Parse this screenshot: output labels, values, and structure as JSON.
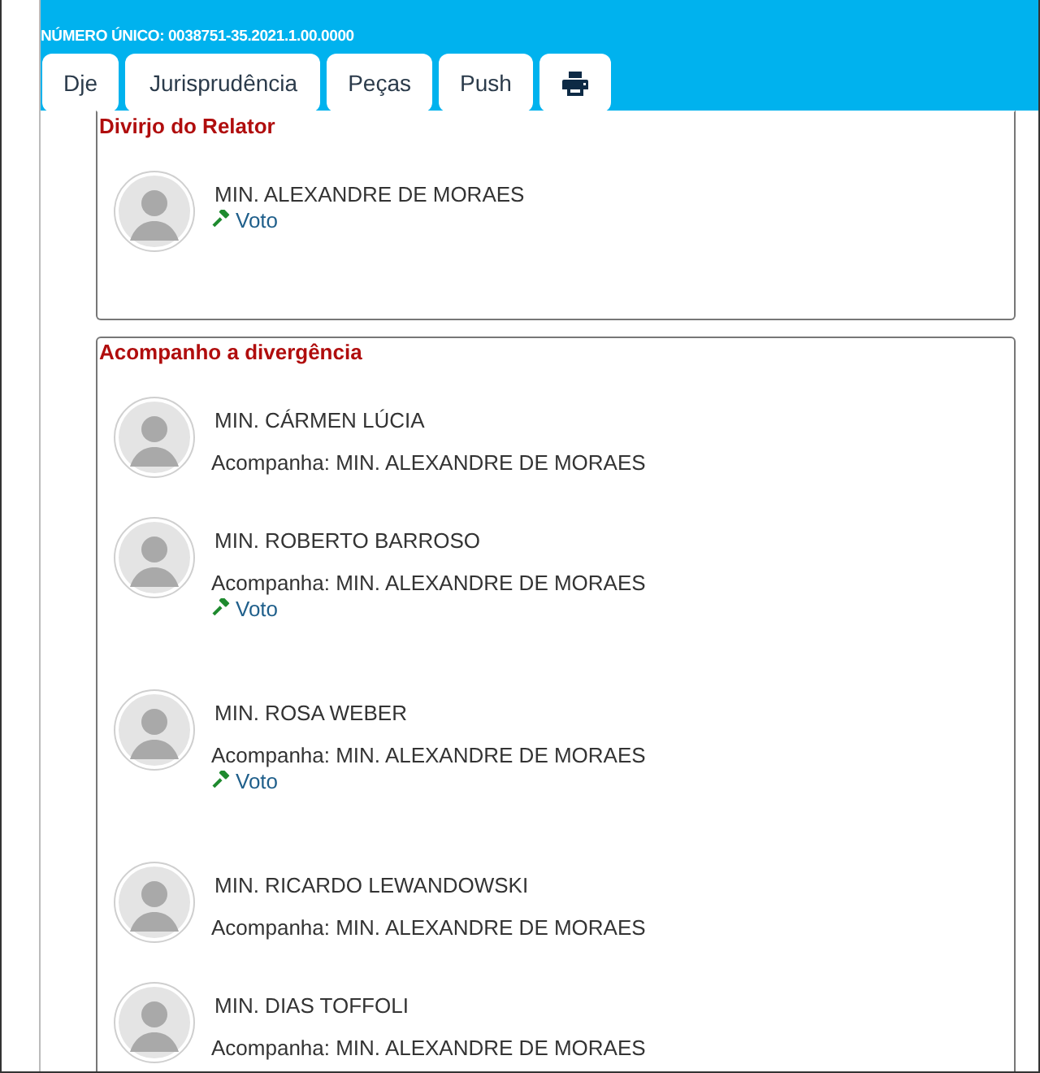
{
  "header": {
    "case_number": "NÚMERO ÚNICO: 0038751-35.2021.1.00.0000"
  },
  "toolbar": {
    "buttons": [
      {
        "kind": "text",
        "label": "Dje"
      },
      {
        "kind": "text",
        "label": "Jurisprudência"
      },
      {
        "kind": "text",
        "label": "Peças"
      },
      {
        "kind": "text",
        "label": "Push"
      },
      {
        "kind": "print"
      }
    ]
  },
  "sections": [
    {
      "title": "Divirjo do Relator",
      "members": [
        {
          "name": "MIN. ALEXANDRE DE MORAES",
          "vote_link": "Voto"
        }
      ]
    },
    {
      "title": "Acompanho a divergência",
      "members": [
        {
          "name": "MIN. CÁRMEN LÚCIA",
          "follows": "Acompanha: MIN. ALEXANDRE DE MORAES"
        },
        {
          "name": "MIN. ROBERTO BARROSO",
          "follows": "Acompanha: MIN. ALEXANDRE DE MORAES",
          "vote_link": "Voto"
        },
        {
          "name": "MIN. ROSA WEBER",
          "follows": "Acompanha: MIN. ALEXANDRE DE MORAES",
          "vote_link": "Voto"
        },
        {
          "name": "MIN. RICARDO LEWANDOWSKI",
          "follows": "Acompanha: MIN. ALEXANDRE DE MORAES"
        },
        {
          "name": "MIN. DIAS TOFFOLI",
          "follows": "Acompanha: MIN. ALEXANDRE DE MORAES"
        }
      ]
    }
  ]
}
